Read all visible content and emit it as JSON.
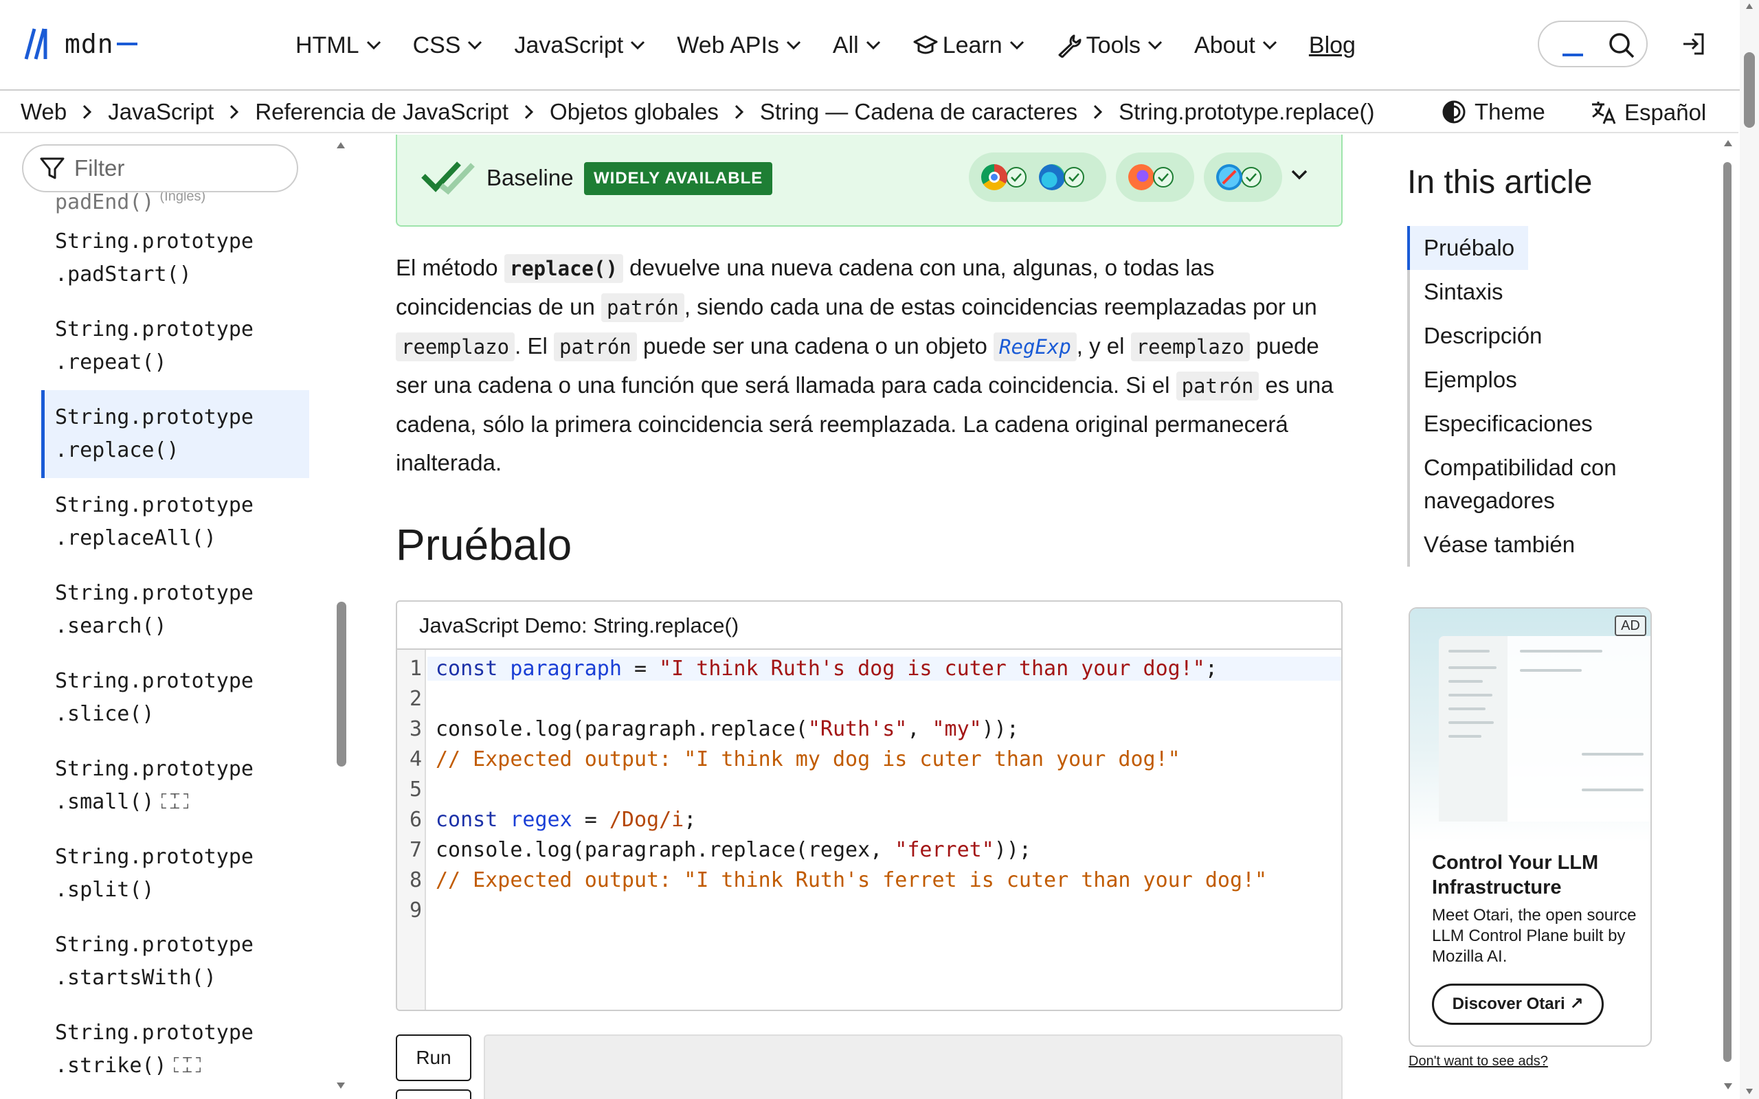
{
  "header": {
    "logo_text": "mdn",
    "nav": [
      {
        "label": "HTML",
        "icon": "chevron-down-icon"
      },
      {
        "label": "CSS",
        "icon": "chevron-down-icon"
      },
      {
        "label": "JavaScript",
        "icon": "chevron-down-icon"
      },
      {
        "label": "Web APIs",
        "icon": "chevron-down-icon"
      },
      {
        "label": "All",
        "icon": "chevron-down-icon"
      },
      {
        "label": "Learn",
        "icon": "graduation-cap-icon"
      },
      {
        "label": "Tools",
        "icon": "wrench-icon"
      },
      {
        "label": "About",
        "icon": "chevron-down-icon"
      },
      {
        "label": "Blog"
      }
    ]
  },
  "breadcrumb": {
    "items": [
      "Web",
      "JavaScript",
      "Referencia de JavaScript",
      "Objetos globales",
      "String — Cadena de caracteres",
      "String.prototype.replace()"
    ],
    "theme_label": "Theme",
    "language_label": "Español"
  },
  "sidebar": {
    "filter_placeholder": "Filter",
    "partial_item": "padEnd()",
    "partial_tag": "(Inglés)",
    "items": [
      {
        "line1": "String.prototype",
        "line2": ".padStart()"
      },
      {
        "line1": "String.prototype",
        "line2": ".repeat()"
      },
      {
        "line1": "String.prototype",
        "line2": ".replace()"
      },
      {
        "line1": "String.prototype",
        "line2": ".replaceAll()"
      },
      {
        "line1": "String.prototype",
        "line2": ".search()"
      },
      {
        "line1": "String.prototype",
        "line2": ".slice()"
      },
      {
        "line1": "String.prototype",
        "line2": ".small()"
      },
      {
        "line1": "String.prototype",
        "line2": ".split()"
      },
      {
        "line1": "String.prototype",
        "line2": ".startsWith()"
      },
      {
        "line1": "String.prototype",
        "line2": ".strike()"
      }
    ]
  },
  "baseline": {
    "label": "Baseline",
    "badge": "WIDELY AVAILABLE",
    "browsers": [
      "chrome",
      "edge",
      "firefox",
      "safari"
    ],
    "accent": "#1e7e34"
  },
  "article": {
    "p1": "El método",
    "code_replace": "replace()",
    "p2": "devuelve una nueva cadena con una, algunas, o todas las coincidencias de un",
    "code_patron1": "patrón",
    "p3": ", siendo cada una de estas coincidencias reemplazadas por un",
    "code_reemplazo1": "reemplazo",
    "p4": ". El",
    "code_patron2": "patrón",
    "p5": "puede ser una cadena o un objeto",
    "link_regexp": "RegExp",
    "p6": ", y el",
    "code_reemplazo2": "reemplazo",
    "p7": "puede ser una cadena o una función que será llamada para cada coincidencia. Si el",
    "code_patron3": "patrón",
    "p8": "es una cadena, sólo la primera coincidencia será reemplazada. La cadena original permanecerá inalterada.",
    "heading": "Pruébalo"
  },
  "demo": {
    "title": "JavaScript Demo: String.replace()",
    "run_label": "Run",
    "lines": [
      "1",
      "2",
      "3",
      "4",
      "5",
      "6",
      "7",
      "8",
      "9"
    ],
    "code": {
      "l1_kw": "const",
      "l1_var": "paragraph",
      "l1_eq": " = ",
      "l1_str": "\"I think Ruth's dog is cuter than your dog!\"",
      "l1_end": ";",
      "l3_a": "console.log(paragraph.replace(",
      "l3_s1": "\"Ruth's\"",
      "l3_b": ", ",
      "l3_s2": "\"my\"",
      "l3_c": "));",
      "l4": "// Expected output: \"I think my dog is cuter than your dog!\"",
      "l6_kw": "const",
      "l6_var": "regex",
      "l6_eq": " = ",
      "l6_rx": "/Dog/i",
      "l6_end": ";",
      "l7_a": "console.log(paragraph.replace(regex, ",
      "l7_s": "\"ferret\"",
      "l7_b": "));",
      "l8": "// Expected output: \"I think Ruth's ferret is cuter than your dog!\""
    }
  },
  "toc": {
    "title": "In this article",
    "items": [
      "Pruébalo",
      "Sintaxis",
      "Descripción",
      "Ejemplos",
      "Especificaciones",
      "Compatibilidad con navegadores",
      "Véase también"
    ]
  },
  "ad": {
    "tag": "AD",
    "title": "Control Your LLM Infrastructure",
    "body": "Meet Otari, the open source LLM Control Plane built by Mozilla AI.",
    "cta": "Discover Otari",
    "note": "Don't want to see ads?"
  }
}
